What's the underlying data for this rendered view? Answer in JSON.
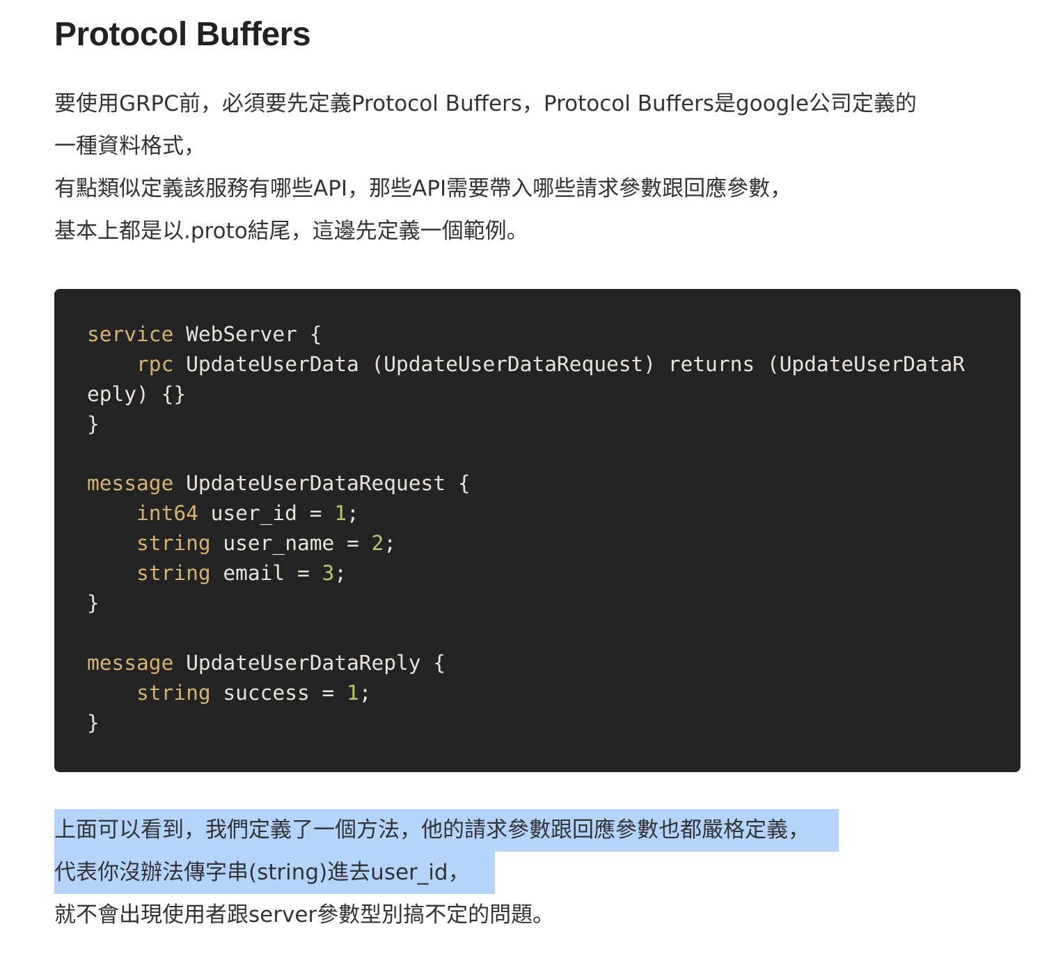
{
  "heading": "Protocol Buffers",
  "intro": {
    "lines": [
      "要使用GRPC前，必須要先定義Protocol Buffers，Protocol Buffers是google公司定義的",
      "一種資料格式，",
      "有點類似定義該服務有哪些API，那些API需要帶入哪些請求參數跟回應參數，",
      "基本上都是以.proto結尾，這邊先定義一個範例。"
    ]
  },
  "code": {
    "line1": {
      "kw": "service",
      "rest": " WebServer {"
    },
    "line2": {
      "indent": "    ",
      "kw": "rpc",
      "rest": " UpdateUserData (UpdateUserDataRequest) returns (UpdateUserDataR"
    },
    "line3": {
      "text": "eply) {}"
    },
    "line4": {
      "text": "}"
    },
    "line5": {
      "text": ""
    },
    "line6": {
      "kw": "message",
      "rest": " UpdateUserDataRequest {"
    },
    "line7": {
      "indent": "    ",
      "kw": "int64",
      "mid": " user_id = ",
      "num": "1",
      "end": ";"
    },
    "line8": {
      "indent": "    ",
      "kw": "string",
      "mid": " user_name = ",
      "num": "2",
      "end": ";"
    },
    "line9": {
      "indent": "    ",
      "kw": "string",
      "mid": " email = ",
      "num": "3",
      "end": ";"
    },
    "line10": {
      "text": "}"
    },
    "line11": {
      "text": ""
    },
    "line12": {
      "kw": "message",
      "rest": " UpdateUserDataReply {"
    },
    "line13": {
      "indent": "    ",
      "kw": "string",
      "mid": " success = ",
      "num": "1",
      "end": ";"
    },
    "line14": {
      "text": "}"
    }
  },
  "outro": {
    "lines": [
      "上面可以看到，我們定義了一個方法，他的請求參數跟回應參數也都嚴格定義，",
      "代表你沒辦法傳字串(string)進去user_id，",
      "就不會出現使用者跟server參數型別搞不定的問題。"
    ]
  },
  "colors": {
    "code_background": "#232323",
    "keyword": "#d6b370",
    "number": "#b5c96a",
    "selection_highlight": "#b4d4fb"
  }
}
